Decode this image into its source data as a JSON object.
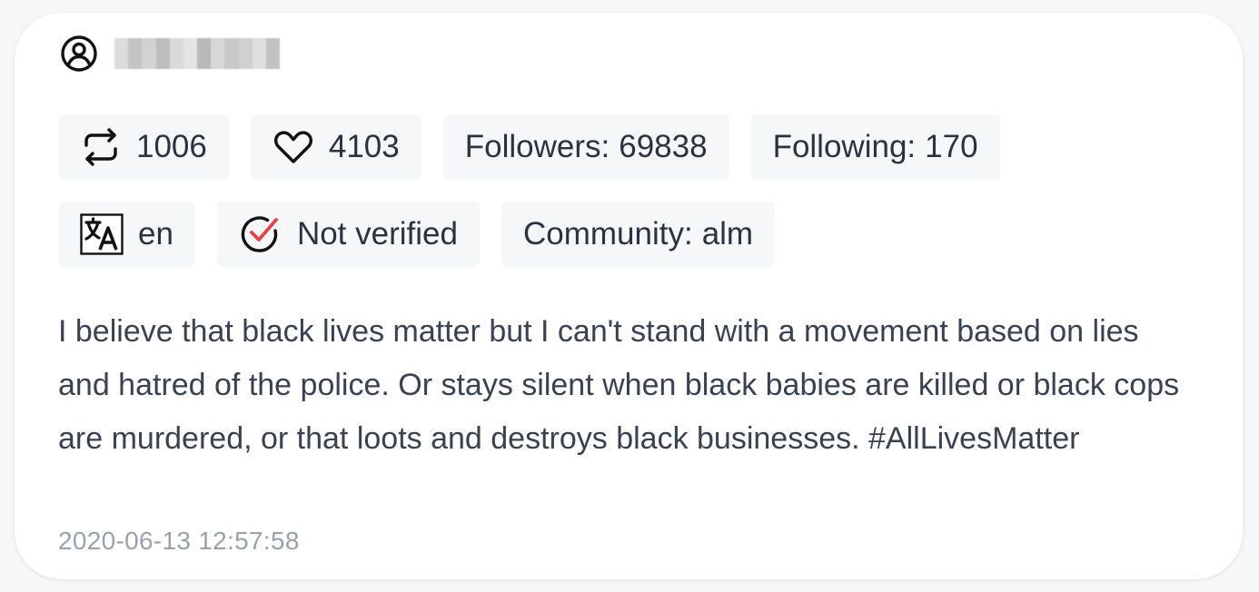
{
  "user": {
    "icon": "user-circle-icon",
    "name_redacted": true
  },
  "stats": {
    "retweets": {
      "icon": "retweet-icon",
      "value": "1006"
    },
    "likes": {
      "icon": "heart-icon",
      "value": "4103"
    },
    "followers": {
      "label": "Followers:",
      "value": "69838"
    },
    "following": {
      "label": "Following:",
      "value": "170"
    }
  },
  "meta": {
    "language": {
      "icon": "translate-icon",
      "value": "en"
    },
    "verified": {
      "icon": "check-circle-icon",
      "value": "Not verified"
    },
    "community": {
      "label": "Community:",
      "value": "alm"
    }
  },
  "tweet": {
    "text": "I believe that black lives matter but I can't stand with a movement based on lies and hatred of the police. Or stays silent when black babies are killed or black cops are murdered, or that loots and destroys black businesses. #AllLivesMatter",
    "timestamp": "2020-06-13 12:57:58"
  },
  "colors": {
    "chip_background": "#f6f7f9",
    "text_primary": "#2b3240",
    "timestamp": "#9aa1ab",
    "verified_check": "#e0454e"
  }
}
